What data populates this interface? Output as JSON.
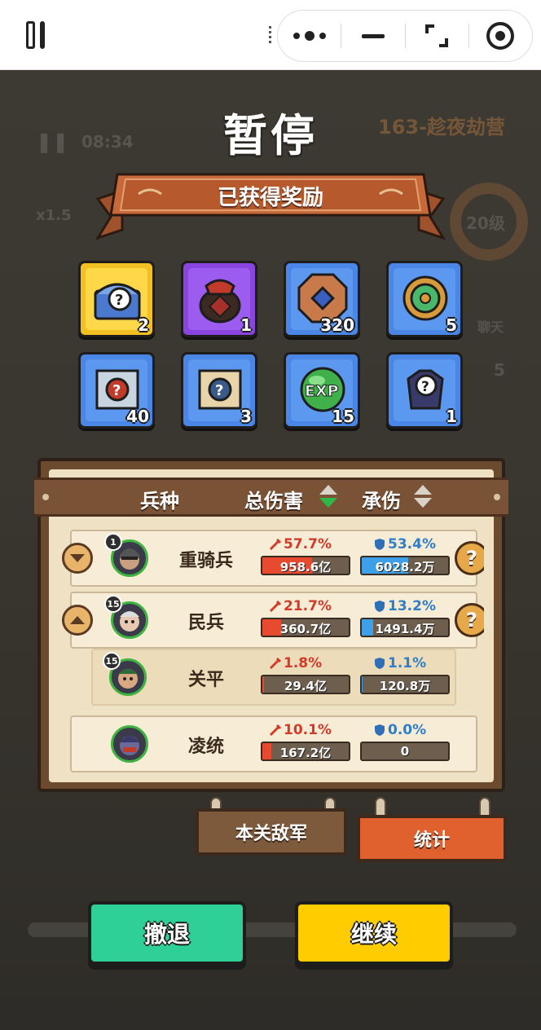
{
  "game": {
    "title": "暂停",
    "banner_label": "已获得奖励",
    "background": {
      "timer": "08:34",
      "stage_name": "163-趁夜劫营",
      "speed": "x1.5",
      "level": "20级",
      "chat": "聊天",
      "side_count": "5"
    },
    "rewards": [
      {
        "count": "2",
        "color": "gold",
        "icon": "mystery-chest-icon"
      },
      {
        "count": "1",
        "color": "purple",
        "icon": "jar-icon"
      },
      {
        "count": "320",
        "color": "blue",
        "icon": "coin-icon"
      },
      {
        "count": "5",
        "color": "blue",
        "icon": "jade-ring-icon"
      },
      {
        "count": "40",
        "color": "blue",
        "icon": "mystery-scroll-icon"
      },
      {
        "count": "3",
        "color": "blue",
        "icon": "scroll-icon"
      },
      {
        "count": "15",
        "color": "blue",
        "icon": "exp-orb-icon"
      },
      {
        "count": "1",
        "color": "blue",
        "icon": "mystery-armor-icon"
      }
    ],
    "stats_panel": {
      "headers": {
        "unit": "兵种",
        "damage": "总伤害",
        "tank": "承伤"
      },
      "rows": [
        {
          "name": "重骑兵",
          "level": "1",
          "dmg_pct": "57.7%",
          "dmg_val": "958.6亿",
          "dmg_fill": 0.577,
          "tank_pct": "53.4%",
          "tank_val": "6028.2万",
          "tank_fill": 0.534,
          "expand": "collapse",
          "sub": false
        },
        {
          "name": "民兵",
          "level": "15",
          "dmg_pct": "21.7%",
          "dmg_val": "360.7亿",
          "dmg_fill": 0.217,
          "tank_pct": "13.2%",
          "tank_val": "1491.4万",
          "tank_fill": 0.132,
          "expand": "expand",
          "sub": false
        },
        {
          "name": "关平",
          "level": "15",
          "dmg_pct": "1.8%",
          "dmg_val": "29.4亿",
          "dmg_fill": 0.018,
          "tank_pct": "1.1%",
          "tank_val": "120.8万",
          "tank_fill": 0.011,
          "expand": "none",
          "sub": true
        },
        {
          "name": "凌统",
          "level": "",
          "dmg_pct": "10.1%",
          "dmg_val": "167.2亿",
          "dmg_fill": 0.101,
          "tank_pct": "0.0%",
          "tank_val": "0",
          "tank_fill": 0.0,
          "expand": "none",
          "sub": false
        }
      ]
    },
    "tabs": {
      "enemy": "本关敌军",
      "stats": "统计"
    },
    "buttons": {
      "retreat": "撤退",
      "continue": "继续"
    }
  }
}
